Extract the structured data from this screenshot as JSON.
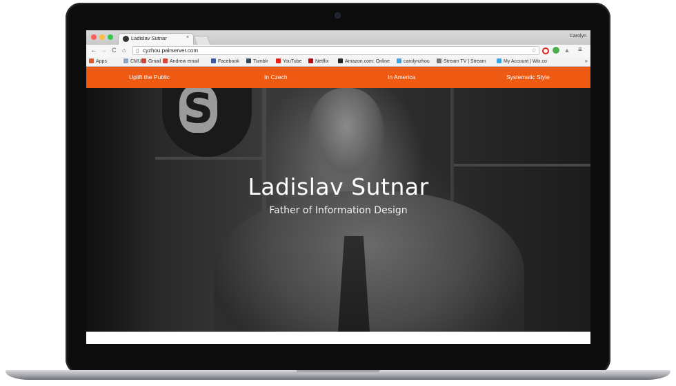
{
  "browser": {
    "tab_title": "Ladislav Sutnar",
    "tab_close": "×",
    "profile_name": "Carolyn",
    "url": "cyzhou.pairserver.com",
    "nav": {
      "back": "←",
      "forward": "→",
      "reload": "C",
      "home": "⌂"
    },
    "bookmarks": [
      {
        "label": "Apps",
        "icon": "apps-grid-icon",
        "color": "#e05a2a"
      },
      {
        "label": "CMU",
        "icon": "folder-icon",
        "color": "#8aa9c8"
      },
      {
        "label": "Gmail",
        "icon": "gmail-icon",
        "color": "#d44638"
      },
      {
        "label": "Andrew email",
        "icon": "gmail-icon",
        "color": "#d44638"
      },
      {
        "label": "Facebook",
        "icon": "facebook-icon",
        "color": "#3b5998"
      },
      {
        "label": "Tumblr",
        "icon": "tumblr-icon",
        "color": "#35465c"
      },
      {
        "label": "YouTube",
        "icon": "youtube-icon",
        "color": "#e62117"
      },
      {
        "label": "Netflix",
        "icon": "netflix-icon",
        "color": "#b9090b"
      },
      {
        "label": "Amazon.com: Online",
        "icon": "amazon-icon",
        "color": "#222222"
      },
      {
        "label": "carolynzhou",
        "icon": "wix-icon",
        "color": "#3aa3e0"
      },
      {
        "label": "Stream TV | Stream",
        "icon": "stream-icon",
        "color": "#777777"
      },
      {
        "label": "My Account | Wix.co",
        "icon": "wix-icon",
        "color": "#3aa3e0"
      }
    ],
    "bookmarks_more": "»"
  },
  "site": {
    "nav": [
      "Uplift the Public",
      "In Czech",
      "In America",
      "Systematic Style"
    ],
    "hero": {
      "title": "Ladislav Sutnar",
      "subtitle": "Father of Information Design"
    },
    "accent_color": "#ef5a13"
  }
}
